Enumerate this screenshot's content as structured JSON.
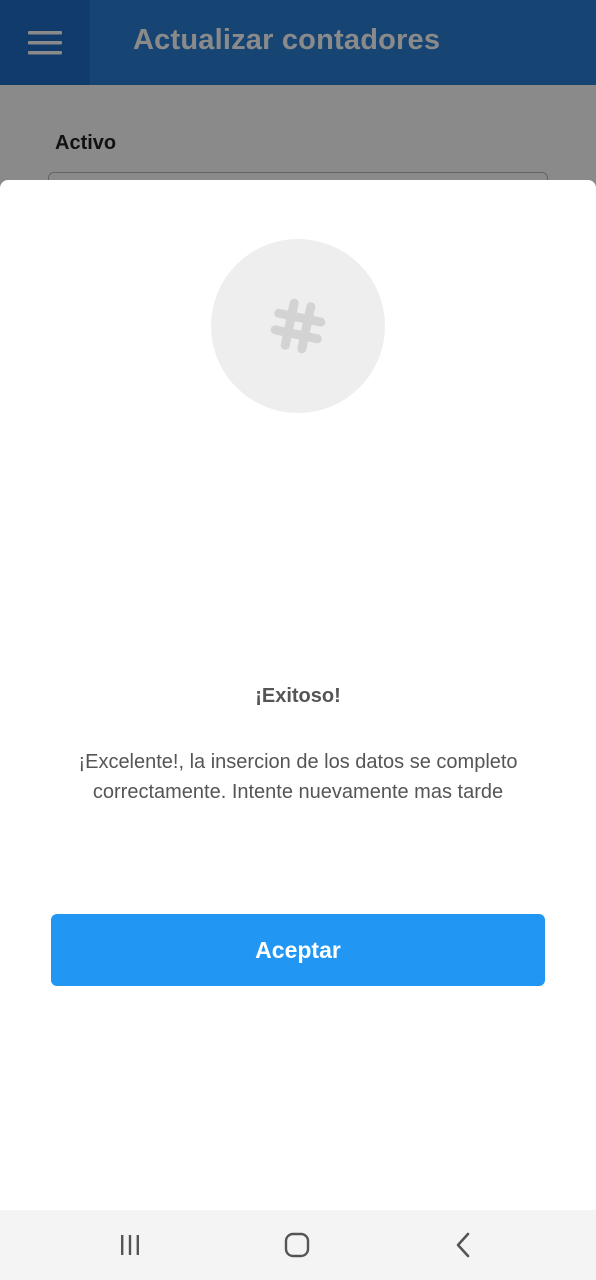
{
  "header": {
    "title": "Actualizar contadores",
    "menu_icon": "hamburger-menu-icon"
  },
  "form": {
    "field_label": "Activo"
  },
  "dialog": {
    "icon": "hashtag-icon",
    "title": "¡Exitoso!",
    "message": "¡Excelente!, la insercion de los datos se completo correctamente. Intente nuevamente mas tarde",
    "accept_label": "Aceptar"
  },
  "system_nav": {
    "recents_icon": "recent-apps-icon",
    "home_icon": "home-icon",
    "back_icon": "back-icon"
  },
  "colors": {
    "app_bar": "#2a7fd4",
    "accent": "#2196f3",
    "icon_circle": "#eeeeee"
  }
}
